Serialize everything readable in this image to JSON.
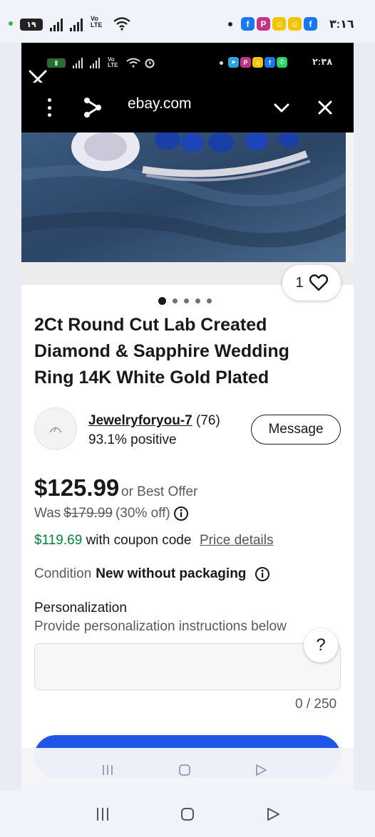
{
  "outer_status_bar": {
    "battery_level": "١٩",
    "time": "٣:١٦",
    "volte_label": "Vo LTE",
    "app_icons": [
      "facebook-icon",
      "picsart-icon",
      "snapchat-icon",
      "snapchat-icon",
      "facebook-icon"
    ]
  },
  "inner_status_bar": {
    "time": "٢:٣٨",
    "volte_label": "Vo LTE",
    "app_icons": [
      "telegram-icon",
      "picsart-icon",
      "snapchat-icon",
      "facebook-icon",
      "whatsapp-icon"
    ]
  },
  "browser": {
    "url": "ebay.com"
  },
  "listing": {
    "like_count": "1",
    "image_count": 5,
    "active_image_index": 0,
    "title": "2Ct Round Cut Lab Created Diamond & Sapphire Wedding Ring 14K White Gold Plated",
    "seller": {
      "name": "Jewelryforyou-7",
      "score": "(76)",
      "positive": "93.1% positive",
      "message_label": "Message"
    },
    "price": {
      "current": "$125.99",
      "best_offer": "or Best Offer",
      "was_label": "Was",
      "was_price": "$179.99",
      "discount": "(30% off)",
      "coupon_price": "$119.69",
      "coupon_text": "with coupon code",
      "details_link": "Price details"
    },
    "condition": {
      "label": "Condition",
      "value": "New without packaging"
    },
    "personalization": {
      "label": "Personalization",
      "hint": "Provide personalization instructions below",
      "value": "",
      "char_count": "0 / 250",
      "help_label": "?"
    }
  },
  "colors": {
    "accent_blue": "#1f56e8",
    "coupon_green": "#05823f",
    "text_primary": "#191919",
    "text_secondary": "#5a5a5a"
  }
}
